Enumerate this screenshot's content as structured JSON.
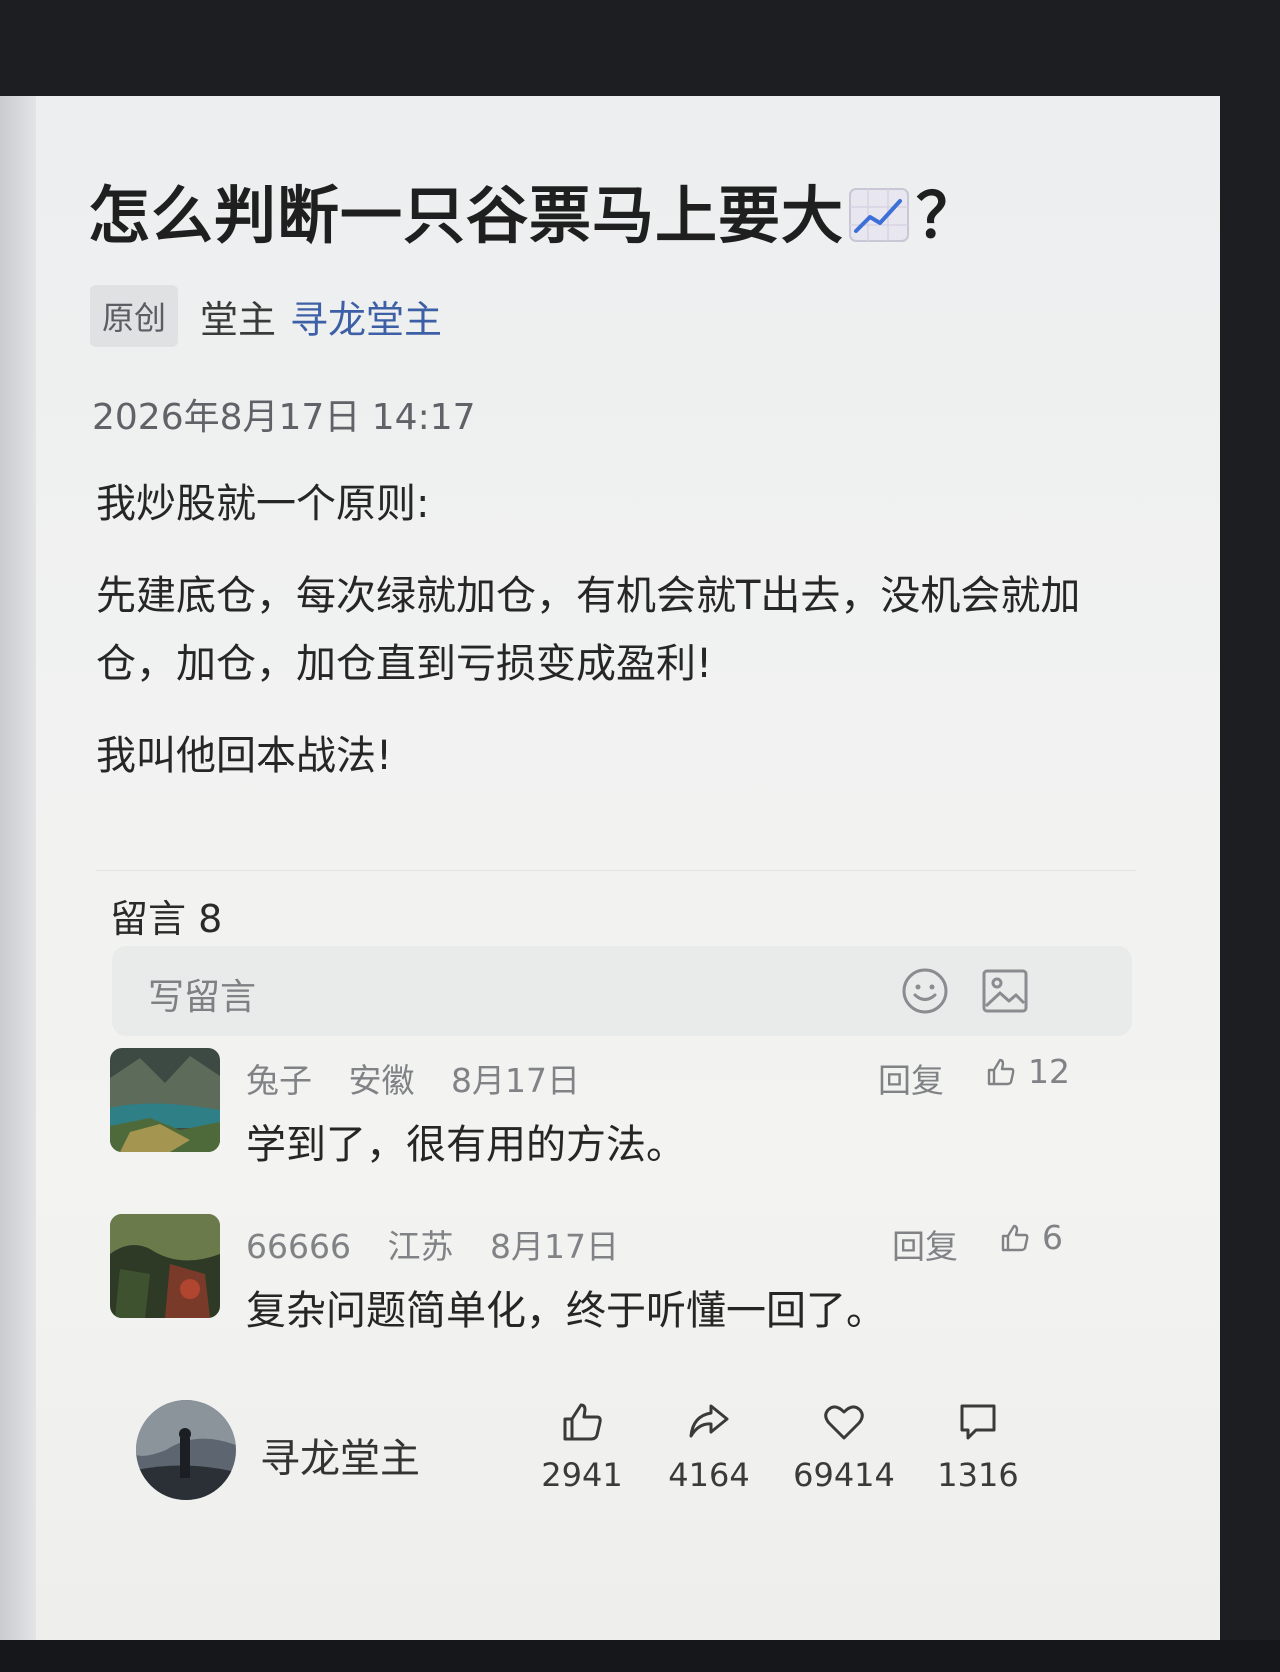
{
  "article": {
    "title": "怎么判断一只谷票马上要大",
    "title_suffix": "？",
    "tag": "原创",
    "author_prefix": "堂主",
    "author_link": "寻龙堂主",
    "date": "2026年8月17日 14:17",
    "paragraphs": [
      "我炒股就一个原则:",
      "先建底仓，每次绿就加仓，有机会就T出去，没机会就加仓，加仓，加仓直到亏损变成盈利!",
      "我叫他回本战法!"
    ]
  },
  "comments_section": {
    "header": "留言 8",
    "write_placeholder": "写留言",
    "icons": [
      "emoji-icon",
      "image-icon"
    ],
    "items": [
      {
        "user": "兔子",
        "region": "安徽",
        "date": "8月17日",
        "reply_label": "回复",
        "likes": "12",
        "text": "学到了，很有用的方法。"
      },
      {
        "user": "66666",
        "region": "江苏",
        "date": "8月17日",
        "reply_label": "回复",
        "likes": "6",
        "text": "复杂问题简单化，终于听懂一回了。"
      }
    ]
  },
  "bottom_bar": {
    "account_name": "寻龙堂主",
    "stats": [
      {
        "icon": "thumbs-up-icon",
        "value": "2941"
      },
      {
        "icon": "share-icon",
        "value": "4164"
      },
      {
        "icon": "heart-icon",
        "value": "69414"
      },
      {
        "icon": "comment-icon",
        "value": "1316"
      }
    ]
  },
  "colors": {
    "link": "#3c5fa6",
    "text": "#262626",
    "muted": "#808286"
  }
}
